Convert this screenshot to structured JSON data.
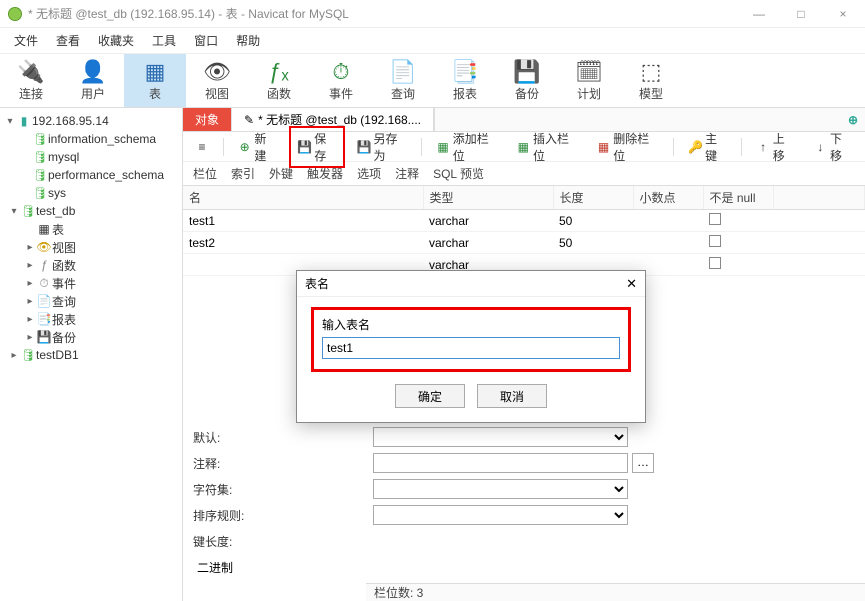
{
  "window": {
    "title": "* 无标题 @test_db (192.168.95.14) - 表 - Navicat for MySQL"
  },
  "menu": {
    "file": "文件",
    "view": "查看",
    "favorites": "收藏夹",
    "tools": "工具",
    "window": "窗口",
    "help": "帮助"
  },
  "main_toolbar": {
    "connect": "连接",
    "user": "用户",
    "table": "表",
    "view": "视图",
    "function": "函数",
    "event": "事件",
    "query": "查询",
    "report": "报表",
    "backup": "备份",
    "schedule": "计划",
    "model": "模型"
  },
  "tree": {
    "server": "192.168.95.14",
    "dbs": [
      "information_schema",
      "mysql",
      "performance_schema",
      "sys"
    ],
    "open_db": "test_db",
    "children": {
      "table": "表",
      "view": "视图",
      "function": "函数",
      "event": "事件",
      "query": "查询",
      "report": "报表",
      "backup": "备份"
    },
    "other_db": "testDB1"
  },
  "tabs": {
    "objects": "对象",
    "editor": "* 无标题 @test_db (192.168...."
  },
  "editor_toolbar": {
    "new": "新建",
    "save": "保存",
    "save_as": "另存为",
    "add_field": "添加栏位",
    "insert_field": "插入栏位",
    "delete_field": "删除栏位",
    "primary_key": "主键",
    "move_up": "上移",
    "move_down": "下移"
  },
  "sub_tabs": {
    "fields": "栏位",
    "index": "索引",
    "fk": "外键",
    "trigger": "触发器",
    "options": "选项",
    "comment": "注释",
    "sql": "SQL 预览"
  },
  "grid": {
    "cols": {
      "name": "名",
      "type": "类型",
      "length": "长度",
      "decimal": "小数点",
      "notnull": "不是 null"
    },
    "rows": [
      {
        "name": "test1",
        "type": "varchar",
        "length": "50",
        "decimal": "",
        "notnull": false
      },
      {
        "name": "test2",
        "type": "varchar",
        "length": "50",
        "decimal": "",
        "notnull": false
      },
      {
        "name": "",
        "type": "varchar",
        "length": "",
        "decimal": "",
        "notnull": false
      }
    ]
  },
  "modal": {
    "title": "表名",
    "label": "输入表名",
    "value": "test1",
    "ok": "确定",
    "cancel": "取消"
  },
  "bottom": {
    "default": "默认:",
    "comment": "注释:",
    "charset": "字符集:",
    "collation": "排序规则:",
    "keylen": "键长度:",
    "binary": "二进制"
  },
  "status": {
    "text": "栏位数: 3"
  }
}
